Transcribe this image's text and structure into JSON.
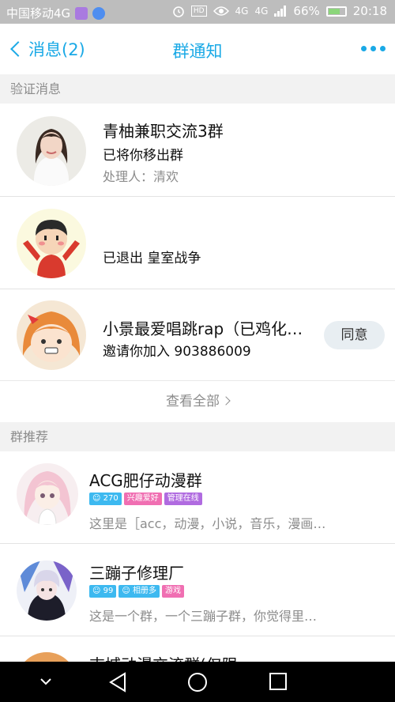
{
  "status_bar": {
    "carrier": "中国移动4G",
    "network_primary": "4G",
    "network_secondary": "4G",
    "battery": "66%",
    "battery_level": 0.66,
    "time": "20:18"
  },
  "header": {
    "back_label": "消息(2)",
    "title": "群通知"
  },
  "sections": {
    "verify": "验证消息",
    "recommend": "群推荐"
  },
  "verify_items": [
    {
      "name": "青柚兼职交流3群",
      "line2": "已将你移出群",
      "line3": "处理人：清欢"
    },
    {
      "name": "",
      "line2": "已退出 皇室战争",
      "line3": ""
    },
    {
      "name": "小景最爱唱跳rap（已鸡化…",
      "line2": "邀请你加入 903886009",
      "line3": "",
      "action": "同意"
    }
  ],
  "view_all": "查看全部",
  "recommend_items": [
    {
      "name": "ACG肥仔动漫群",
      "tags": [
        {
          "text": "270",
          "color": "#3db9f0",
          "icon": "person-icon"
        },
        {
          "text": "兴趣爱好",
          "color": "#f06fb2"
        },
        {
          "text": "管理在线",
          "color": "#b06be0"
        }
      ],
      "desc": "这里是［acc，动漫，小说，音乐，漫画…"
    },
    {
      "name": "三蹦子修理厂",
      "tags": [
        {
          "text": "99",
          "color": "#3db9f0",
          "icon": "person-icon"
        },
        {
          "text": "相册多",
          "color": "#3db9f0",
          "icon": "person-icon"
        },
        {
          "text": "游戏",
          "color": "#f06fb2"
        }
      ],
      "desc": "这是一个群，一个三蹦子群，你觉得里…"
    },
    {
      "name": "吉城动漫交流群(仅限",
      "tags": [],
      "desc": ""
    }
  ],
  "colors": {
    "accent": "#1aa9e6",
    "status_bar": "#bdbdbd",
    "nav_bar": "#000000"
  }
}
